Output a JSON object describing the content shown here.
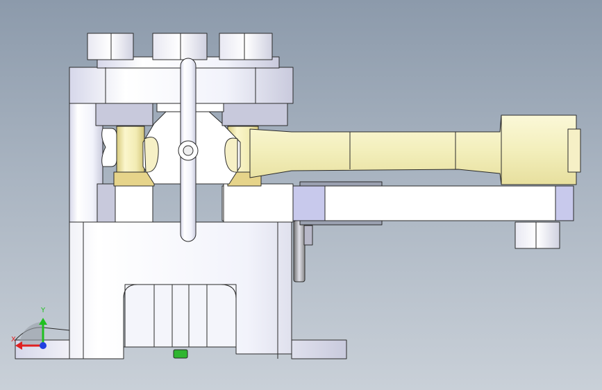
{
  "viewport": {
    "background_top": "#8c9aab",
    "background_bottom": "#c9d0d8"
  },
  "model": {
    "metal_color": "#ecedf6",
    "metal_shade": "#c8c9dc",
    "brass_color": "#f3efbc",
    "brass_shade": "#d9cf8a",
    "edge_color": "#2a2a2a",
    "green_part": "#2fb52f"
  },
  "triad": {
    "x_label": "X",
    "y_label": "Y",
    "x_color": "#e02020",
    "y_color": "#20c020",
    "z_color": "#2040e0"
  }
}
